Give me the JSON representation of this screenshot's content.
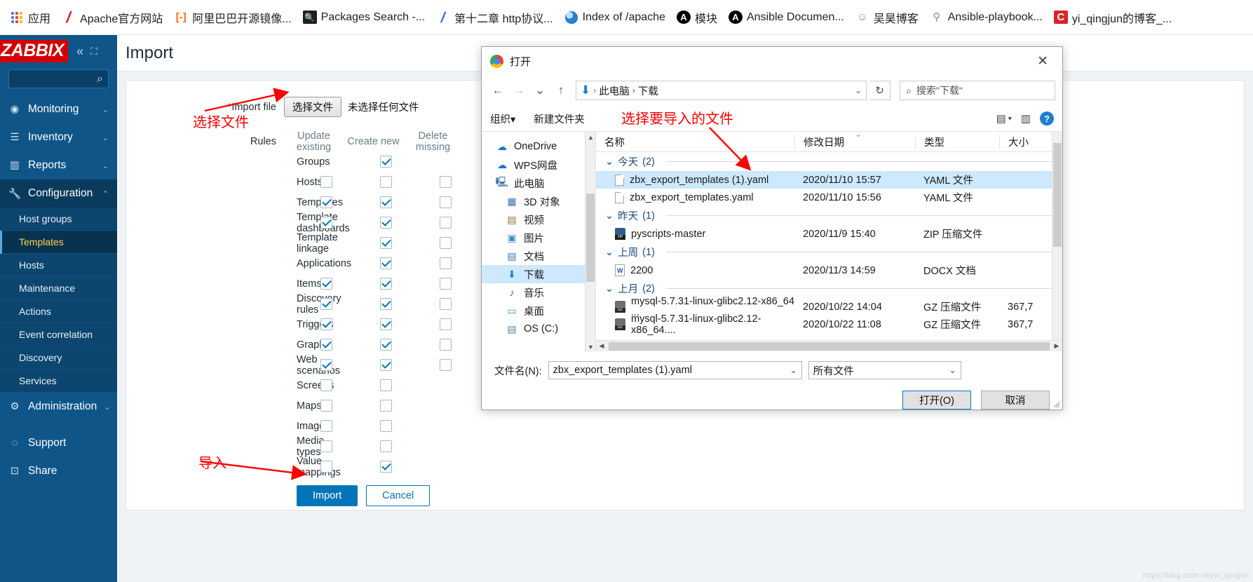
{
  "browser": {
    "bookmarks": [
      {
        "label": "应用",
        "icon": "apps-grid-icon"
      },
      {
        "label": "Apache官方网站",
        "icon": "apache-feather-icon"
      },
      {
        "label": "阿里巴巴开源镜像...",
        "icon": "alibaba-icon"
      },
      {
        "label": "Packages Search -...",
        "icon": "packages-search-icon"
      },
      {
        "label": "第十二章 http协议...",
        "icon": "note-icon"
      },
      {
        "label": "Index of /apache",
        "icon": "globe-icon"
      },
      {
        "label": "模块",
        "icon": "ansible-icon"
      },
      {
        "label": "Ansible Documen...",
        "icon": "ansible-icon"
      },
      {
        "label": "吴昊博客",
        "icon": "blog-icon"
      },
      {
        "label": "Ansible-playbook...",
        "icon": "playbook-icon"
      },
      {
        "label": "yi_qingjun的博客_...",
        "icon": "csdn-icon"
      }
    ]
  },
  "sidebar": {
    "logo": "ZABBIX",
    "collapse_icon": "«",
    "expand_icon": "⛶",
    "search_placeholder": "",
    "items": [
      {
        "label": "Monitoring",
        "icon": "eye-icon",
        "caret": "⌄"
      },
      {
        "label": "Inventory",
        "icon": "list-icon",
        "caret": "⌄"
      },
      {
        "label": "Reports",
        "icon": "chart-icon",
        "caret": "⌄"
      },
      {
        "label": "Configuration",
        "icon": "wrench-icon",
        "caret": "⌃"
      }
    ],
    "config_subitems": [
      "Host groups",
      "Templates",
      "Hosts",
      "Maintenance",
      "Actions",
      "Event correlation",
      "Discovery",
      "Services"
    ],
    "selected_subitem": "Templates",
    "administration": {
      "label": "Administration",
      "icon": "gear-icon",
      "caret": "⌄"
    },
    "bottom": [
      {
        "label": "Support",
        "icon": "lifebuoy-icon"
      },
      {
        "label": "Share",
        "icon": "share-z-icon"
      }
    ]
  },
  "page": {
    "title": "Import",
    "import_file_label": "Import file",
    "required_star": "*",
    "choose_file_button": "选择文件",
    "no_file_text": "未选择任何文件",
    "rules_label": "Rules",
    "column_headers": [
      "Update existing",
      "Create new",
      "Delete missing"
    ],
    "rules": [
      {
        "name": "Groups",
        "update": null,
        "create": true,
        "delete": null
      },
      {
        "name": "Hosts",
        "update": false,
        "create": false,
        "delete": false
      },
      {
        "name": "Templates",
        "update": true,
        "create": true,
        "delete": false
      },
      {
        "name": "Template dashboards",
        "update": true,
        "create": true,
        "delete": false
      },
      {
        "name": "Template linkage",
        "update": null,
        "create": true,
        "delete": false
      },
      {
        "name": "Applications",
        "update": null,
        "create": true,
        "delete": false
      },
      {
        "name": "Items",
        "update": true,
        "create": true,
        "delete": false
      },
      {
        "name": "Discovery rules",
        "update": true,
        "create": true,
        "delete": false
      },
      {
        "name": "Triggers",
        "update": true,
        "create": true,
        "delete": false
      },
      {
        "name": "Graphs",
        "update": true,
        "create": true,
        "delete": false
      },
      {
        "name": "Web scenarios",
        "update": true,
        "create": true,
        "delete": false
      },
      {
        "name": "Screens",
        "update": false,
        "create": false,
        "delete": null
      },
      {
        "name": "Maps",
        "update": false,
        "create": false,
        "delete": null
      },
      {
        "name": "Images",
        "update": false,
        "create": false,
        "delete": null
      },
      {
        "name": "Media types",
        "update": false,
        "create": false,
        "delete": null
      },
      {
        "name": "Value mappings",
        "update": false,
        "create": true,
        "delete": null
      }
    ],
    "import_button": "Import",
    "cancel_button": "Cancel"
  },
  "annotations": {
    "choose_file": "选择文件",
    "select_file_to_import": "选择要导入的文件",
    "import": "导入"
  },
  "dialog": {
    "title": "打开",
    "close_icon": "✕",
    "nav": {
      "back_icon": "←",
      "forward_icon": "→",
      "recent_icon": "⌄",
      "up_icon": "↑",
      "breadcrumb": [
        "此电脑",
        "下载"
      ],
      "breadcrumb_sep": "›",
      "dropdown_icon": "⌄",
      "refresh_icon": "↻",
      "search_placeholder": "搜索\"下载\"",
      "search_icon": "search-icon"
    },
    "toolbar": {
      "organize": "组织",
      "organize_caret": "▾",
      "new_folder": "新建文件夹",
      "view_icon": "list-view-icon",
      "view_caret": "▾",
      "pane_icon": "preview-pane-icon",
      "help_icon": "?"
    },
    "nav_pane": [
      {
        "label": "OneDrive",
        "icon": "onedrive-cloud-icon",
        "indent": false,
        "selected": false
      },
      {
        "label": "WPS网盘",
        "icon": "wps-cloud-icon",
        "indent": false,
        "selected": false
      },
      {
        "label": "此电脑",
        "icon": "this-pc-icon",
        "indent": false,
        "selected": false
      },
      {
        "label": "3D 对象",
        "icon": "3d-objects-icon",
        "indent": true,
        "selected": false
      },
      {
        "label": "视频",
        "icon": "videos-icon",
        "indent": true,
        "selected": false
      },
      {
        "label": "图片",
        "icon": "pictures-icon",
        "indent": true,
        "selected": false
      },
      {
        "label": "文档",
        "icon": "documents-icon",
        "indent": true,
        "selected": false
      },
      {
        "label": "下载",
        "icon": "downloads-icon",
        "indent": true,
        "selected": true
      },
      {
        "label": "音乐",
        "icon": "music-icon",
        "indent": true,
        "selected": false
      },
      {
        "label": "桌面",
        "icon": "desktop-icon",
        "indent": true,
        "selected": false
      },
      {
        "label": "OS (C:)",
        "icon": "drive-icon",
        "indent": true,
        "selected": false
      }
    ],
    "columns": [
      "名称",
      "修改日期",
      "类型",
      "大小"
    ],
    "groups": [
      {
        "label": "今天",
        "count": "(2)",
        "collapse_icon": "⌄",
        "files": [
          {
            "name": "zbx_export_templates (1).yaml",
            "date": "2020/11/10 15:57",
            "type": "YAML 文件",
            "size": "",
            "icon": "yaml-file-icon",
            "selected": true
          },
          {
            "name": "zbx_export_templates.yaml",
            "date": "2020/11/10 15:56",
            "type": "YAML 文件",
            "size": "",
            "icon": "yaml-file-icon",
            "selected": false
          }
        ]
      },
      {
        "label": "昨天",
        "count": "(1)",
        "collapse_icon": "⌄",
        "files": [
          {
            "name": "pyscripts-master",
            "date": "2020/11/9 15:40",
            "type": "ZIP 压缩文件",
            "size": "",
            "icon": "zip-file-icon",
            "selected": false
          }
        ]
      },
      {
        "label": "上周",
        "count": "(1)",
        "collapse_icon": "⌄",
        "files": [
          {
            "name": "2200",
            "date": "2020/11/3 14:59",
            "type": "DOCX 文档",
            "size": "",
            "icon": "docx-file-icon",
            "selected": false
          }
        ]
      },
      {
        "label": "上月",
        "count": "(2)",
        "collapse_icon": "⌄",
        "files": [
          {
            "name": "mysql-5.7.31-linux-glibc2.12-x86_64 ...",
            "date": "2020/10/22 14:04",
            "type": "GZ 压缩文件",
            "size": "367,7",
            "icon": "gz-file-icon",
            "selected": false
          },
          {
            "name": "mysql-5.7.31-linux-glibc2.12-x86_64....",
            "date": "2020/10/22 11:08",
            "type": "GZ 压缩文件",
            "size": "367,7",
            "icon": "gz-file-icon",
            "selected": false
          }
        ]
      }
    ],
    "footer": {
      "filename_label": "文件名(N):",
      "filename_value": "zbx_export_templates (1).yaml",
      "filetype_value": "所有文件",
      "open_button": "打开(O)",
      "cancel_button": "取消"
    }
  },
  "watermark": "https://blog.csdn.net/yi_qingjun"
}
